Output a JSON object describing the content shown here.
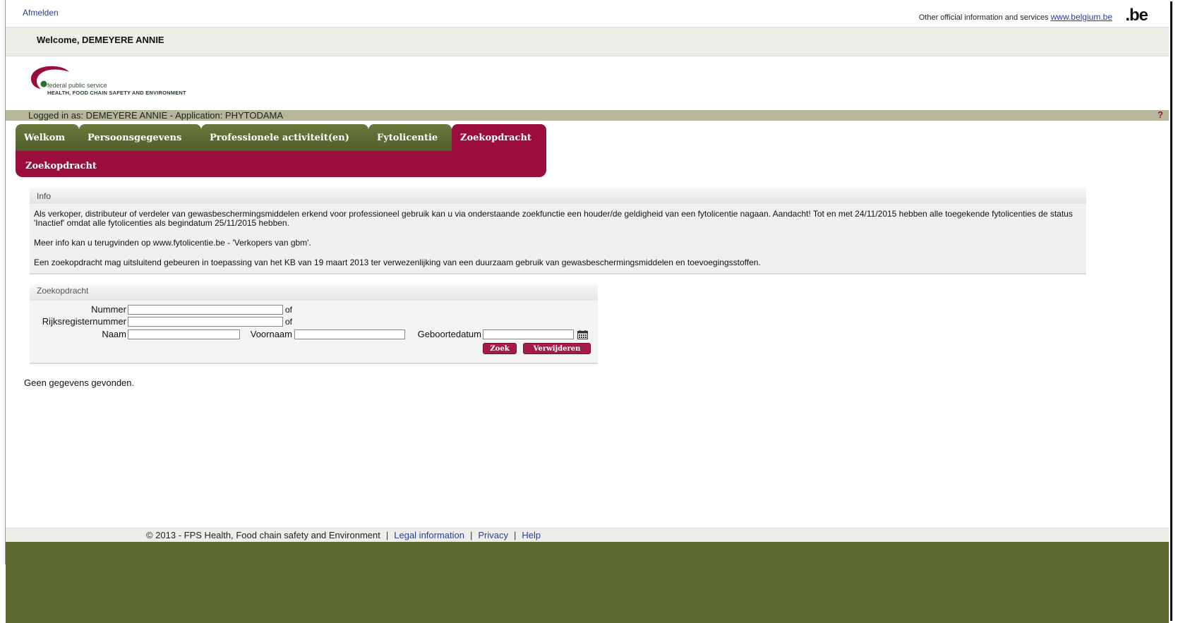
{
  "topbar": {
    "logout": "Afmelden",
    "official_text": "Other official information and services",
    "official_link": "www.belgium.be",
    "be_logo": ".be"
  },
  "welcome": "Welcome, DEMEYERE ANNIE",
  "logo": {
    "line1": "federal public service",
    "line2": "HEALTH, FOOD CHAIN SAFETY AND ENVIRONMENT"
  },
  "status": {
    "text": "Logged in as: DEMEYERE ANNIE - Application: PHYTODAMA",
    "help": "?"
  },
  "tabs": [
    {
      "label": "Welkom"
    },
    {
      "label": "Persoonsgegevens"
    },
    {
      "label": "Professionele activiteit(en)"
    },
    {
      "label": "Fytolicentie"
    },
    {
      "label": "Zoekopdracht",
      "active": true
    }
  ],
  "subtab": "Zoekopdracht",
  "info": {
    "title": "Info",
    "p1": "Als verkoper, distributeur of verdeler van gewasbeschermingsmiddelen erkend voor professioneel gebruik kan u via onderstaande zoekfunctie een houder/de geldigheid van een fytolicentie nagaan. Aandacht! Tot en met 24/11/2015 hebben alle toegekende fytolicenties de status 'Inactief' omdat alle fytolicenties als begindatum 25/11/2015 hebben.",
    "p2": "Meer info kan u terugvinden op www.fytolicentie.be - 'Verkopers van gbm'.",
    "p3": "Een zoekopdracht mag uitsluitend gebeuren in toepassing van het KB van 19 maart 2013 ter verwezenlijking van een duurzaam gebruik van gewasbeschermingsmiddelen en toevoegingsstoffen."
  },
  "search": {
    "title": "Zoekopdracht",
    "nummer_label": "Nummer",
    "nummer_value": "",
    "rijks_label": "Rijksregisternummer",
    "rijks_value": "",
    "of": "of",
    "naam_label": "Naam",
    "naam_value": "",
    "voornaam_label": "Voornaam",
    "voornaam_value": "",
    "geboorte_label": "Geboortedatum",
    "geboorte_value": "",
    "zoek_button": "Zoek",
    "verwijderen_button": "Verwijderen"
  },
  "result_text": "Geen gegevens gevonden.",
  "footer": {
    "copyright": "© 2013 - FPS Health, Food chain safety and Environment",
    "legal": "Legal information",
    "privacy": "Privacy",
    "help": "Help",
    "separator": "|"
  },
  "colors": {
    "brand_green": "#5e6b30",
    "tab_green": "#5a6a30",
    "accent_burgundy": "#9b0e3c",
    "status_strip": "#b6b69c",
    "link_blue": "#2a3f8f"
  }
}
